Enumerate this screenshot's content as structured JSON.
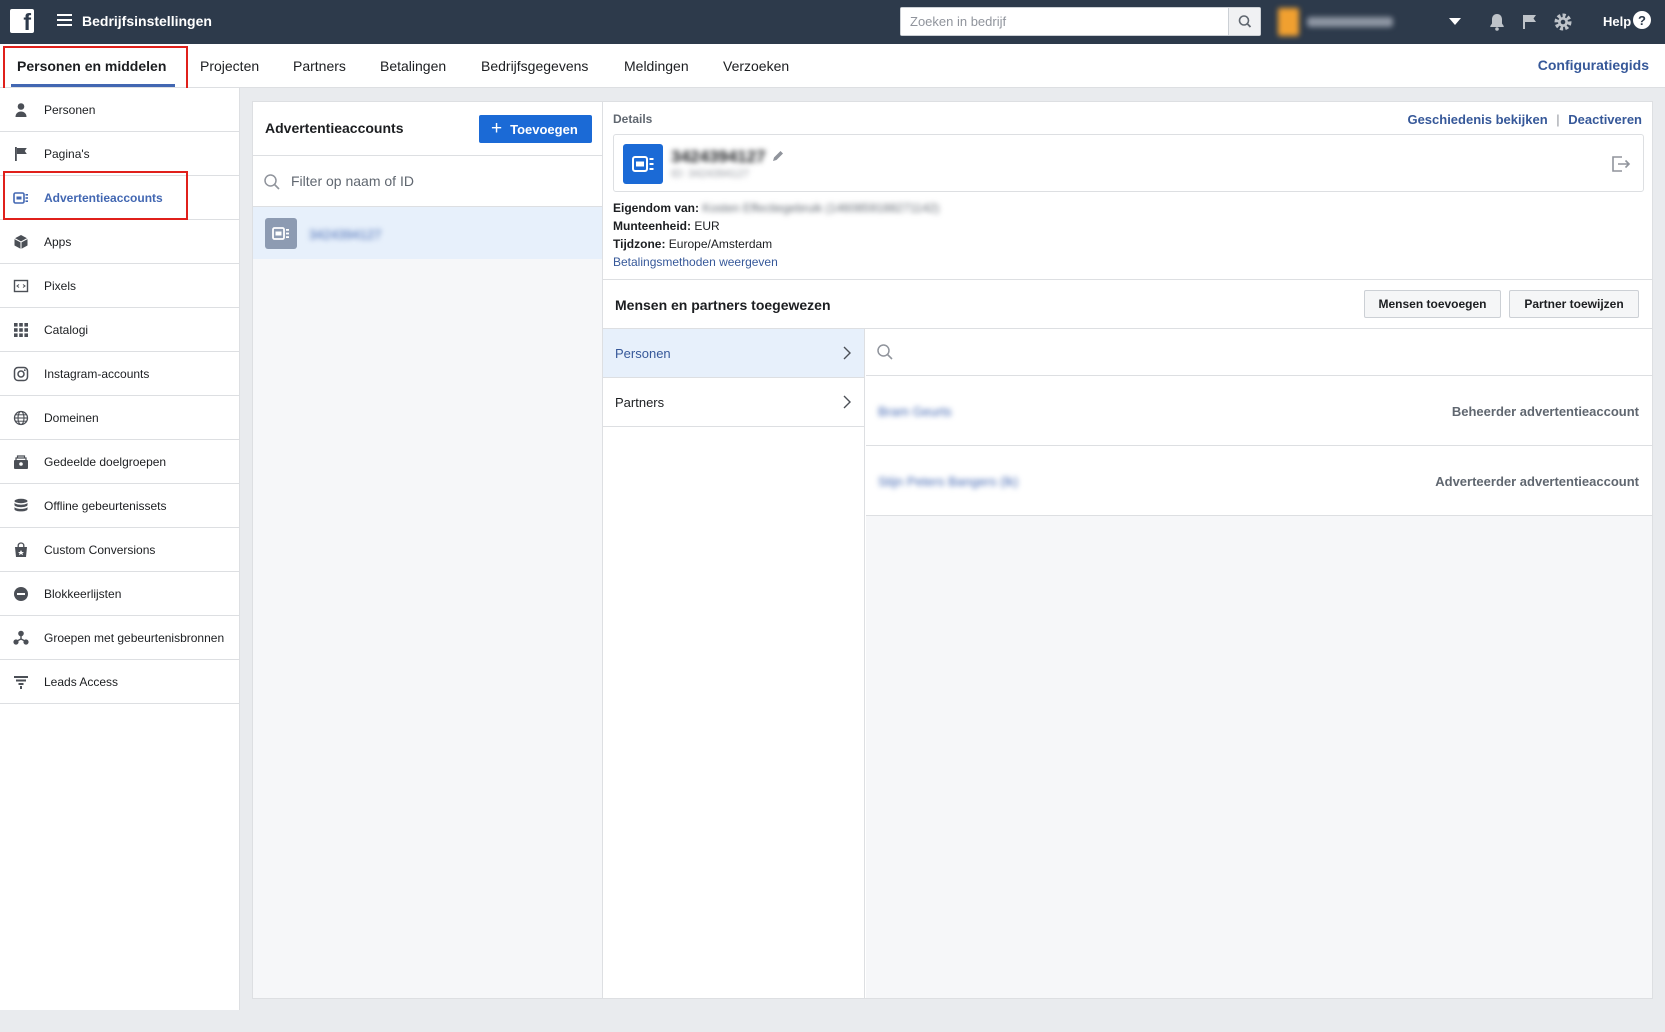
{
  "topbar": {
    "logo": "f",
    "title": "Bedrijfsinstellingen",
    "search_placeholder": "Zoeken in bedrijf",
    "account_name": "Kosten Effectiegebruik",
    "help": "Help"
  },
  "tabs": [
    {
      "label": "Personen en middelen",
      "active": true
    },
    {
      "label": "Projecten"
    },
    {
      "label": "Partners"
    },
    {
      "label": "Betalingen"
    },
    {
      "label": "Bedrijfsgegevens"
    },
    {
      "label": "Meldingen"
    },
    {
      "label": "Verzoeken"
    }
  ],
  "config_guide": "Configuratiegids",
  "sidebar": {
    "items": [
      {
        "label": "Personen",
        "icon": "person-icon"
      },
      {
        "label": "Pagina's",
        "icon": "flag-icon"
      },
      {
        "label": "Advertentieaccounts",
        "icon": "ad-account-icon",
        "active": true
      },
      {
        "label": "Apps",
        "icon": "cube-icon"
      },
      {
        "label": "Pixels",
        "icon": "pixel-code-icon"
      },
      {
        "label": "Catalogi",
        "icon": "grid-icon"
      },
      {
        "label": "Instagram-accounts",
        "icon": "instagram-icon"
      },
      {
        "label": "Domeinen",
        "icon": "globe-icon"
      },
      {
        "label": "Gedeelde doelgroepen",
        "icon": "audience-icon"
      },
      {
        "label": "Offline gebeurtenissets",
        "icon": "database-icon"
      },
      {
        "label": "Custom Conversions",
        "icon": "bag-icon"
      },
      {
        "label": "Blokkeerlijsten",
        "icon": "block-icon"
      },
      {
        "label": "Groepen met gebeurtenisbronnen",
        "icon": "group-icon"
      },
      {
        "label": "Leads Access",
        "icon": "funnel-icon"
      }
    ]
  },
  "accounts_panel": {
    "title": "Advertentieaccounts",
    "add_label": "Toevoegen",
    "filter_placeholder": "Filter op naam of ID",
    "accounts": [
      {
        "name": "3424394127"
      }
    ]
  },
  "details": {
    "heading": "Details",
    "history_link": "Geschiedenis bekijken",
    "separator": "|",
    "deactivate_link": "Deactiveren",
    "account_number": "3424394127",
    "account_id_line": "ID: 3424394127",
    "owner_label": "Eigendom van:",
    "owner_value": "Kosten Effectiegebruik (1460859188271142)",
    "currency_label": "Munteenheid:",
    "currency_value": "EUR",
    "timezone_label": "Tijdzone:",
    "timezone_value": "Europe/Amsterdam",
    "payment_link": "Betalingsmethoden weergeven"
  },
  "assign": {
    "title": "Mensen en partners toegewezen",
    "add_people": "Mensen toevoegen",
    "assign_partner": "Partner toewijzen",
    "categories": [
      {
        "label": "Personen",
        "selected": true
      },
      {
        "label": "Partners"
      }
    ],
    "people": [
      {
        "name": "Bram Geurts",
        "role": "Beheerder advertentieaccount"
      },
      {
        "name": "Stijn Peters Bangers (lk)",
        "role": "Adverteerder advertentieaccount"
      }
    ]
  }
}
